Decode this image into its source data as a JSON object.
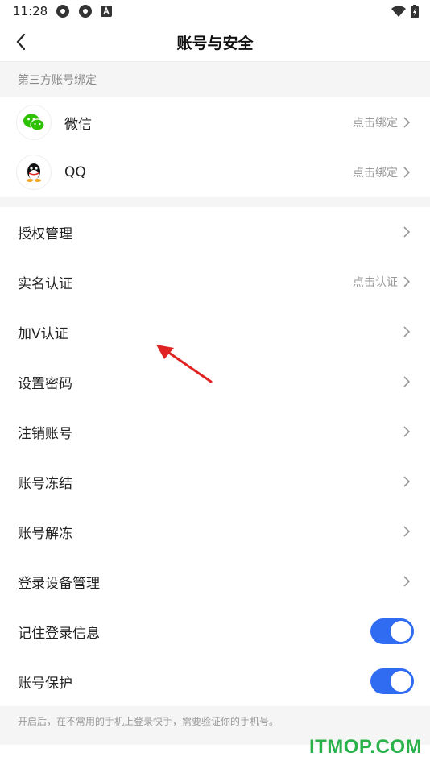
{
  "status": {
    "time": "11:28"
  },
  "header": {
    "title": "账号与安全"
  },
  "third_party": {
    "section_title": "第三方账号绑定",
    "items": [
      {
        "label": "微信",
        "hint": "点击绑定"
      },
      {
        "label": "QQ",
        "hint": "点击绑定"
      }
    ]
  },
  "settings": {
    "items": [
      {
        "label": "授权管理",
        "hint": ""
      },
      {
        "label": "实名认证",
        "hint": "点击认证"
      },
      {
        "label": "加V认证",
        "hint": ""
      },
      {
        "label": "设置密码",
        "hint": ""
      },
      {
        "label": "注销账号",
        "hint": ""
      },
      {
        "label": "账号冻结",
        "hint": ""
      },
      {
        "label": "账号解冻",
        "hint": ""
      },
      {
        "label": "登录设备管理",
        "hint": ""
      }
    ],
    "toggles": [
      {
        "label": "记住登录信息",
        "on": true
      },
      {
        "label": "账号保护",
        "on": true
      }
    ],
    "note": "开启后，在不常用的手机上登录快手，需要验证你的手机号。"
  },
  "watermark": {
    "text": "ITMOP.COM"
  },
  "colors": {
    "accent": "#2f6cf1",
    "arrow": "#e02424",
    "wechat": "#2dc100",
    "watermark": "#2ab14a"
  }
}
